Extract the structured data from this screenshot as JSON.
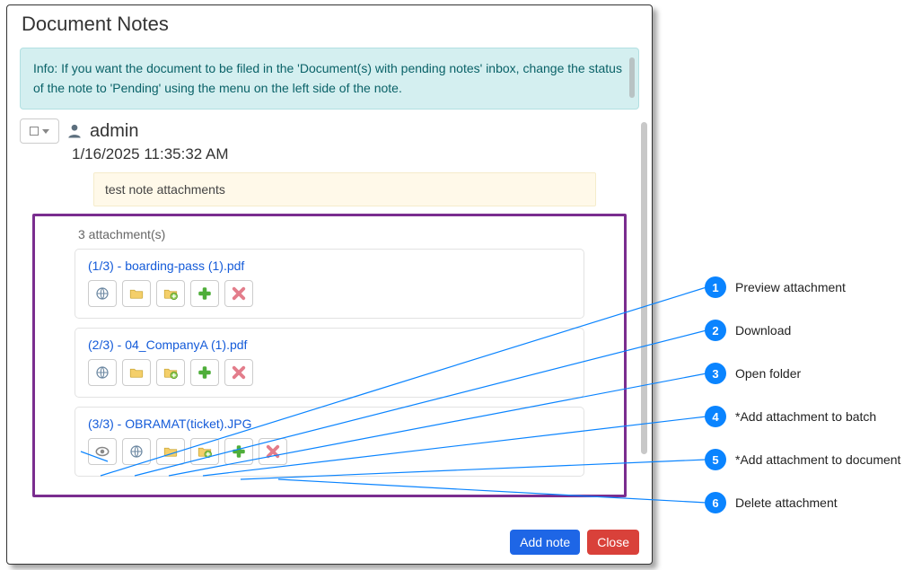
{
  "modal": {
    "title": "Document Notes",
    "info_text": "Info: If you want the document to be filed in the 'Document(s) with pending notes' inbox, change the status of the note to 'Pending' using the menu on the left side of the note."
  },
  "note": {
    "username": "admin",
    "timestamp": "1/16/2025 11:35:32 AM",
    "body": "test note attachments"
  },
  "attachments": {
    "count_label": "3 attachment(s)",
    "items": [
      {
        "label": "(1/3) - boarding-pass (1).pdf",
        "has_preview": false
      },
      {
        "label": "(2/3) - 04_CompanyA (1).pdf",
        "has_preview": false
      },
      {
        "label": "(3/3) - OBRAMAT(ticket).JPG",
        "has_preview": true
      }
    ],
    "action_icons": {
      "preview": "eye-icon",
      "download": "globe-download-icon",
      "open_folder": "folder-icon",
      "add_to_batch": "folder-plus-icon",
      "add_to_document": "plus-icon",
      "delete": "x-icon"
    }
  },
  "footer": {
    "add_note": "Add note",
    "close": "Close"
  },
  "callouts": [
    {
      "n": "1",
      "label": "Preview attachment"
    },
    {
      "n": "2",
      "label": "Download"
    },
    {
      "n": "3",
      "label": "Open folder"
    },
    {
      "n": "4",
      "label": "*Add attachment to batch"
    },
    {
      "n": "5",
      "label": "*Add attachment to document"
    },
    {
      "n": "6",
      "label": "Delete attachment"
    }
  ],
  "colors": {
    "highlight_border": "#7a2d8f",
    "callout_blue": "#0a84ff",
    "link_blue": "#145bd9"
  }
}
